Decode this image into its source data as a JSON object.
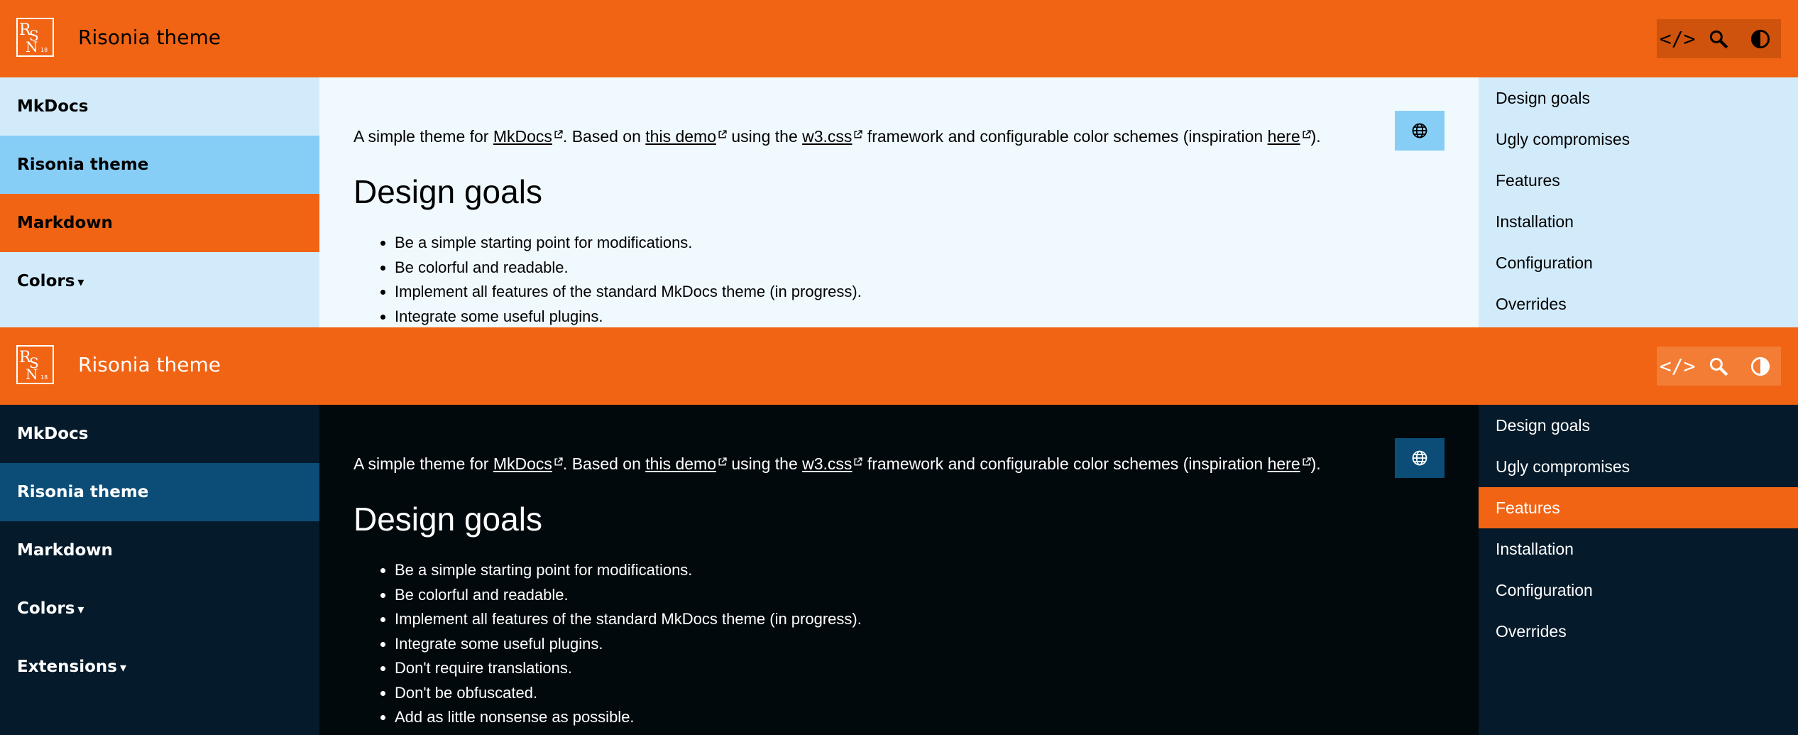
{
  "site_title": "Risonia theme",
  "nav": {
    "mkdocs": "MkDocs",
    "risonia": "Risonia theme",
    "markdown": "Markdown",
    "colors": "Colors",
    "extensions": "Extensions",
    "caret": "▾"
  },
  "toolbar": {
    "code_label": "</>"
  },
  "intro": {
    "p1": "A simple theme for ",
    "link_mkdocs": "MkDocs",
    "p2": ". Based on ",
    "link_demo": "this demo",
    "p3": " using the ",
    "link_w3": "w3.css",
    "p4": " framework and configurable color schemes (inspiration ",
    "link_here": "here",
    "p5": ")."
  },
  "heading": "Design goals",
  "goals": [
    "Be a simple starting point for modifications.",
    "Be colorful and readable.",
    "Implement all features of the standard MkDocs theme (in progress).",
    "Integrate some useful plugins.",
    "Don't require translations.",
    "Don't be obfuscated.",
    "Add as little nonsense as possible."
  ],
  "toc": [
    "Design goals",
    "Ugly compromises",
    "Features",
    "Installation",
    "Configuration",
    "Overrides"
  ],
  "colors": {
    "accent": "#f06414",
    "light_bg": "#f0f9fe",
    "light_sidebar": "#d2ebfb",
    "light_active": "#87cef6",
    "dark_bg": "#02090d",
    "dark_sidebar": "#051a2a",
    "dark_active": "#0b4d77"
  },
  "icons": {
    "logo": "rsn-logo-icon",
    "code": "code-icon",
    "search": "search-icon",
    "contrast": "contrast-toggle-icon",
    "language": "globe-icon",
    "external": "external-link-icon"
  }
}
